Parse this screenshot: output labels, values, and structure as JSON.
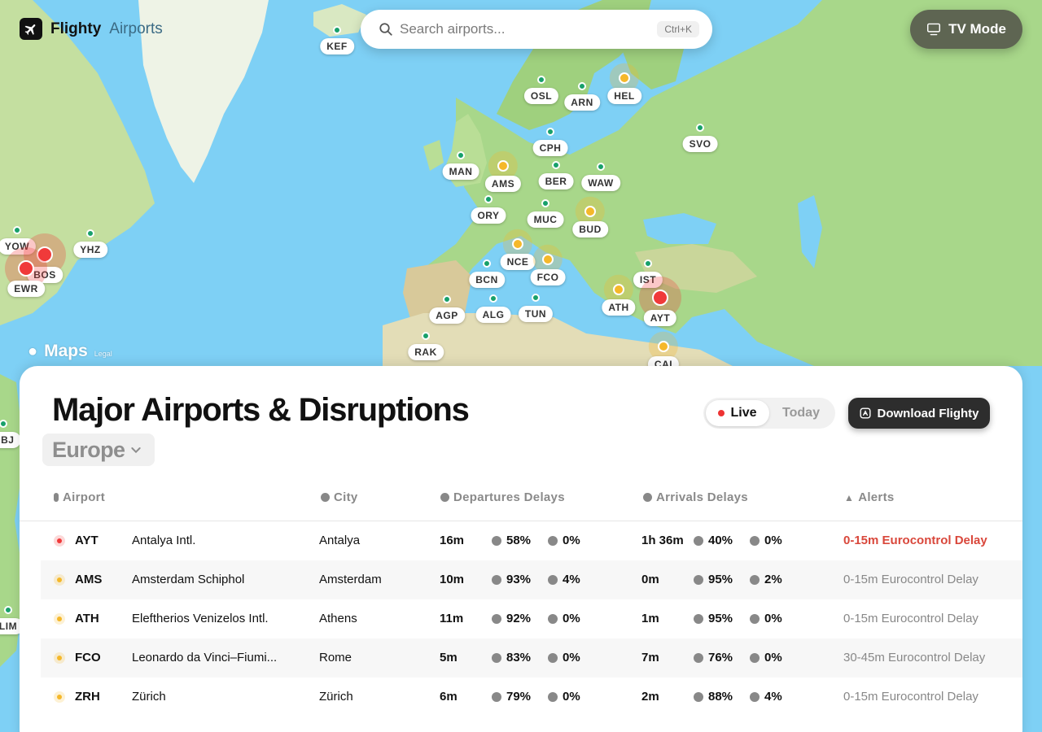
{
  "brand": {
    "name": "Flighty",
    "product": "Airports"
  },
  "search": {
    "placeholder": "Search airports...",
    "shortcut": "Ctrl+K"
  },
  "tv_mode": {
    "label": "TV Mode"
  },
  "map": {
    "attribution": "Maps",
    "legal": "Legal",
    "markers": [
      {
        "code": "KEF",
        "status": "green"
      },
      {
        "code": "OSL",
        "status": "green"
      },
      {
        "code": "ARN",
        "status": "green"
      },
      {
        "code": "HEL",
        "status": "yellow"
      },
      {
        "code": "SVO",
        "status": "green"
      },
      {
        "code": "CPH",
        "status": "green"
      },
      {
        "code": "MAN",
        "status": "green"
      },
      {
        "code": "AMS",
        "status": "yellow"
      },
      {
        "code": "BER",
        "status": "green"
      },
      {
        "code": "WAW",
        "status": "green"
      },
      {
        "code": "ORY",
        "status": "green"
      },
      {
        "code": "MUC",
        "status": "green"
      },
      {
        "code": "BUD",
        "status": "yellow"
      },
      {
        "code": "NCE",
        "status": "yellow"
      },
      {
        "code": "FCO",
        "status": "yellow"
      },
      {
        "code": "BCN",
        "status": "green"
      },
      {
        "code": "IST",
        "status": "green"
      },
      {
        "code": "AGP",
        "status": "green"
      },
      {
        "code": "ALG",
        "status": "green"
      },
      {
        "code": "TUN",
        "status": "green"
      },
      {
        "code": "ATH",
        "status": "yellow"
      },
      {
        "code": "AYT",
        "status": "red"
      },
      {
        "code": "RAK",
        "status": "green"
      },
      {
        "code": "CAI",
        "status": "yellow"
      },
      {
        "code": "YOW",
        "status": "green"
      },
      {
        "code": "YHZ",
        "status": "green"
      },
      {
        "code": "BOS",
        "status": "red"
      },
      {
        "code": "EWR",
        "status": "red"
      },
      {
        "code": "MBJ",
        "status": "green"
      },
      {
        "code": "LIM",
        "status": "green"
      }
    ]
  },
  "panel": {
    "title": "Major Airports & Disruptions",
    "region": "Europe",
    "toggle": {
      "live": "Live",
      "today": "Today"
    },
    "download": "Download Flighty",
    "columns": {
      "airport": "Airport",
      "city": "City",
      "departures": "Departures Delays",
      "arrivals": "Arrivals Delays",
      "alerts": "Alerts"
    },
    "rows": [
      {
        "code": "AYT",
        "name": "Antalya Intl.",
        "city": "Antalya",
        "status": "red",
        "dep_delay": "16m",
        "dep_ontime": "58%",
        "dep_cancel": "0%",
        "arr_delay": "1h 36m",
        "arr_ontime": "40%",
        "arr_cancel": "0%",
        "alert": "0-15m Eurocontrol Delay",
        "alert_severity": "high"
      },
      {
        "code": "AMS",
        "name": "Amsterdam Schiphol",
        "city": "Amsterdam",
        "status": "yellow",
        "dep_delay": "10m",
        "dep_ontime": "93%",
        "dep_cancel": "4%",
        "arr_delay": "0m",
        "arr_ontime": "95%",
        "arr_cancel": "2%",
        "alert": "0-15m Eurocontrol Delay",
        "alert_severity": "normal"
      },
      {
        "code": "ATH",
        "name": "Eleftherios Venizelos Intl.",
        "city": "Athens",
        "status": "yellow",
        "dep_delay": "11m",
        "dep_ontime": "92%",
        "dep_cancel": "0%",
        "arr_delay": "1m",
        "arr_ontime": "95%",
        "arr_cancel": "0%",
        "alert": "0-15m Eurocontrol Delay",
        "alert_severity": "normal"
      },
      {
        "code": "FCO",
        "name": "Leonardo da Vinci–Fiumi...",
        "city": "Rome",
        "status": "yellow",
        "dep_delay": "5m",
        "dep_ontime": "83%",
        "dep_cancel": "0%",
        "arr_delay": "7m",
        "arr_ontime": "76%",
        "arr_cancel": "0%",
        "alert": "30-45m Eurocontrol Delay",
        "alert_severity": "normal"
      },
      {
        "code": "ZRH",
        "name": "Zürich",
        "city": "Zürich",
        "status": "yellow",
        "dep_delay": "6m",
        "dep_ontime": "79%",
        "dep_cancel": "0%",
        "arr_delay": "2m",
        "arr_ontime": "88%",
        "arr_cancel": "4%",
        "alert": "0-15m Eurocontrol Delay",
        "alert_severity": "normal"
      }
    ]
  },
  "colors": {
    "green": "#18a06a",
    "yellow": "#f5b82a",
    "red": "#f03a3a"
  }
}
